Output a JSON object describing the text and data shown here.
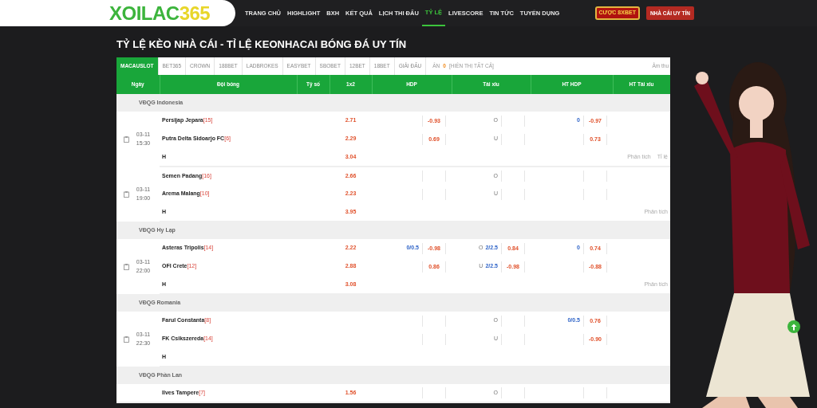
{
  "header": {
    "logo": {
      "text": "XOILAC",
      "accent": "365"
    },
    "nav": [
      {
        "label": "TRANG CHỦ",
        "selected": false
      },
      {
        "label": "HIGHLIGHT",
        "selected": false
      },
      {
        "label": "BXH",
        "selected": false
      },
      {
        "label": "KẾT QUẢ",
        "selected": false
      },
      {
        "label": "LỊCH THI ĐẤU",
        "selected": false
      },
      {
        "label": "TỶ LỆ",
        "selected": true
      },
      {
        "label": "LIVESCORE",
        "selected": false
      },
      {
        "label": "TIN TỨC",
        "selected": false
      },
      {
        "label": "TUYỂN DỤNG",
        "selected": false
      }
    ],
    "buttons": [
      {
        "label": "CƯỢC 8XBET",
        "kind": "outlined"
      },
      {
        "label": "NHÀ CÁI UY TÍN",
        "kind": "solid"
      }
    ]
  },
  "page_title": "TỶ LỆ KÈO NHÀ CÁI - TỈ LỆ KEONHACAI BÓNG ĐÁ UY TÍN",
  "bookmaker_tabs": [
    {
      "label": "MACAUSLOT",
      "selected": true
    },
    {
      "label": "BET365",
      "selected": false
    },
    {
      "label": "CROWN",
      "selected": false
    },
    {
      "label": "188BET",
      "selected": false
    },
    {
      "label": "LADBROKES",
      "selected": false
    },
    {
      "label": "EASYBET",
      "selected": false
    },
    {
      "label": "SBOBET",
      "selected": false
    },
    {
      "label": "12BET",
      "selected": false
    },
    {
      "label": "18BET",
      "selected": false
    },
    {
      "label": "GIẢI ĐẤU",
      "selected": false
    }
  ],
  "filter": {
    "label": "ẨN",
    "count": "0",
    "link": "[HIỂN THỊ TẤT CẢ]"
  },
  "sound_label": "Âm thu",
  "table": {
    "columns": [
      "Ngày",
      "Đội bóng",
      "Tỷ số",
      "1x2",
      "HDP",
      "Tài xỉu",
      "HT HDP",
      "HT Tài xỉu"
    ],
    "leagues": [
      {
        "name": "VĐQG Indonesia",
        "matches": [
          {
            "date": "03-11",
            "time": "15:30",
            "rows": [
              {
                "team": "Persijap Jepara",
                "rank": "[15]",
                "x12": "2.71",
                "hdp_odds": "-0.93",
                "ou_side": "O",
                "ht_hdp_line": "0",
                "ht_hdp_odds": "-0.97"
              },
              {
                "team": "Putra Delta Sidoarjo FC",
                "rank": "[6]",
                "x12": "2.29",
                "hdp_odds": "0.69",
                "ou_side": "U",
                "ht_hdp_odds": "0.73"
              },
              {
                "team": "H",
                "x12": "3.04",
                "links": [
                  "Phân tích",
                  "Tỉ lệ"
                ]
              }
            ]
          },
          {
            "date": "03-11",
            "time": "19:00",
            "rows": [
              {
                "team": "Semen Padang",
                "rank": "[16]",
                "x12": "2.66",
                "ou_side": "O"
              },
              {
                "team": "Arema Malang",
                "rank": "[10]",
                "x12": "2.23",
                "ou_side": "U"
              },
              {
                "team": "H",
                "x12": "3.95",
                "links": [
                  "Phân tích"
                ]
              }
            ]
          }
        ]
      },
      {
        "name": "VĐQG Hy Lạp",
        "matches": [
          {
            "date": "03-11",
            "time": "22:00",
            "rows": [
              {
                "team": "Asteras Tripolis",
                "rank": "[14]",
                "x12": "2.22",
                "hdp_line": "0/0.5",
                "hdp_odds": "-0.98",
                "ou_side": "O",
                "ou_line": "2/2.5",
                "ou_odds": "0.84",
                "ht_hdp_line": "0",
                "ht_hdp_odds": "0.74"
              },
              {
                "team": "OFI Crete",
                "rank": "[12]",
                "x12": "2.88",
                "hdp_odds": "0.86",
                "ou_side": "U",
                "ou_line": "2/2.5",
                "ou_odds": "-0.98",
                "ht_hdp_odds": "-0.88"
              },
              {
                "team": "H",
                "x12": "3.08",
                "links": [
                  "Phân tích"
                ]
              }
            ]
          }
        ]
      },
      {
        "name": "VĐQG Romania",
        "matches": [
          {
            "date": "03-11",
            "time": "22:30",
            "rows": [
              {
                "team": "Farul Constanta",
                "rank": "[8]",
                "ou_side": "O",
                "ht_hdp_line": "0/0.5",
                "ht_hdp_odds": "0.76"
              },
              {
                "team": "FK Csikszereda",
                "rank": "[14]",
                "ou_side": "U",
                "ht_hdp_odds": "-0.90"
              },
              {
                "team": "H"
              }
            ]
          }
        ]
      },
      {
        "name": "VĐQG Phần Lan",
        "matches": [
          {
            "rows": [
              {
                "team": "Ilves Tampere",
                "rank": "[7]",
                "x12": "1.56",
                "ou_side": "O"
              }
            ]
          }
        ]
      }
    ]
  }
}
